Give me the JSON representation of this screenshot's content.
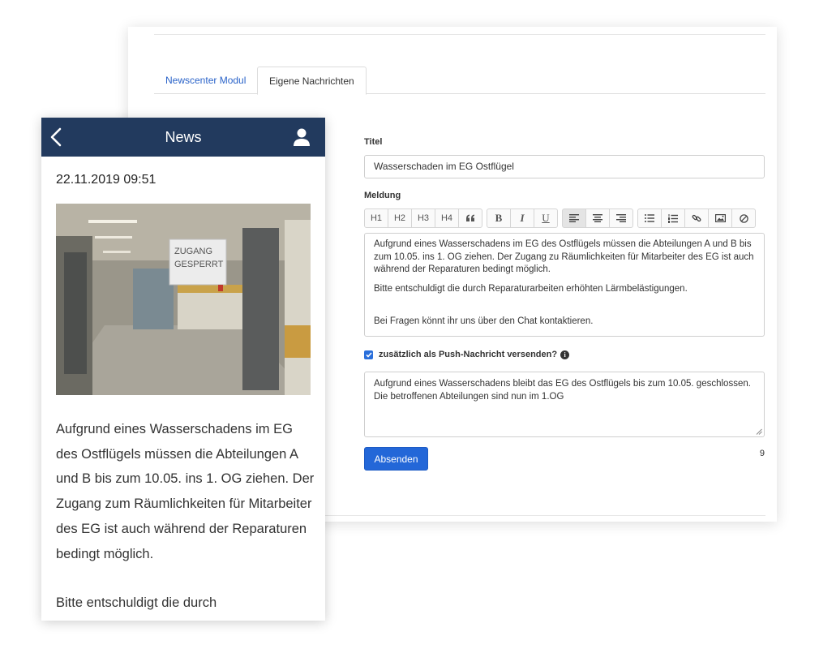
{
  "tabs": [
    {
      "label": "Newscenter Modul",
      "active": false
    },
    {
      "label": "Eigene Nachrichten",
      "active": true
    }
  ],
  "form": {
    "title_label": "Titel",
    "title_value": "Wasserschaden im EG Ostflügel",
    "message_label": "Meldung",
    "toolbar": {
      "headings": [
        "H1",
        "H2",
        "H3",
        "H4"
      ],
      "bold": "B",
      "italic": "I",
      "underline": "U"
    },
    "message_paragraphs": [
      "Aufgrund eines Wasserschadens im EG des Ostflügels müssen die Abteilungen A und B bis zum 10.05. ins 1. OG ziehen. Der Zugang zu Räumlichkeiten für Mitarbeiter des EG ist auch während der Reparaturen bedingt möglich.",
      "Bitte entschuldigt die durch Reparaturarbeiten erhöhten Lärmbelästigungen.",
      "Bei Fragen könnt ihr uns über den Chat kontaktieren."
    ],
    "push_checkbox_label": "zusätzlich als Push-Nachricht versenden?",
    "push_checked": true,
    "push_text": "Aufgrund eines Wasserschadens bleibt das EG des Ostflügels bis zum 10.05. geschlossen. Die betroffenen Abteilungen sind nun im 1.OG",
    "send_label": "Absenden",
    "counter": "9"
  },
  "phone": {
    "title": "News",
    "date": "22.11.2019 09:51",
    "photo_sign": [
      "ZUGANG",
      "GESPERRT"
    ],
    "body_paragraphs": [
      "Aufgrund eines Wasserschadens im EG des Ostflügels müssen die Abteilungen A und B bis zum 10.05. ins 1. OG ziehen. Der Zugang zum Räumlichkeiten für Mitarbeiter des EG ist auch während der Reparaturen bedingt möglich.",
      "Bitte entschuldigt die durch"
    ]
  },
  "colors": {
    "accent": "#2367d8",
    "header": "#223a5e",
    "link": "#2a63c9"
  },
  "icons": [
    "quote-icon",
    "align-left-icon",
    "align-center-icon",
    "align-right-icon",
    "bullet-list-icon",
    "numbered-list-icon",
    "link-icon",
    "image-icon",
    "clear-format-icon",
    "info-icon",
    "back-chevron-icon",
    "user-icon"
  ]
}
